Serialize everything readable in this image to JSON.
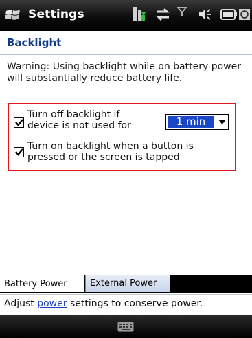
{
  "titlebar": {
    "title": "Settings",
    "icons": [
      "windows-flag-icon",
      "battery-charging-icon",
      "sync-arrows-icon",
      "signal-icon",
      "speaker-icon",
      "battery-icon",
      "clock-icon"
    ]
  },
  "page": {
    "header": "Backlight",
    "warning": "Warning: Using backlight while on battery power will substantially reduce battery life."
  },
  "options": {
    "turn_off": {
      "checked": true,
      "line1": "Turn off backlight if",
      "line2": "device is not used for"
    },
    "timeout": {
      "selected": "1 min"
    },
    "turn_on": {
      "checked": true,
      "line1": "Turn on backlight when a button is",
      "line2": "pressed or the screen is tapped"
    }
  },
  "tabs": [
    {
      "label": "Battery Power",
      "active": true
    },
    {
      "label": "External Power",
      "active": false
    }
  ],
  "hint": {
    "prefix": "Adjust ",
    "link": "power",
    "suffix": " settings to conserve power."
  },
  "colors": {
    "header_text": "#113b86",
    "highlight_border": "#e2141c",
    "dropdown_selected": "#1947c8",
    "link": "#1a3fc4"
  }
}
